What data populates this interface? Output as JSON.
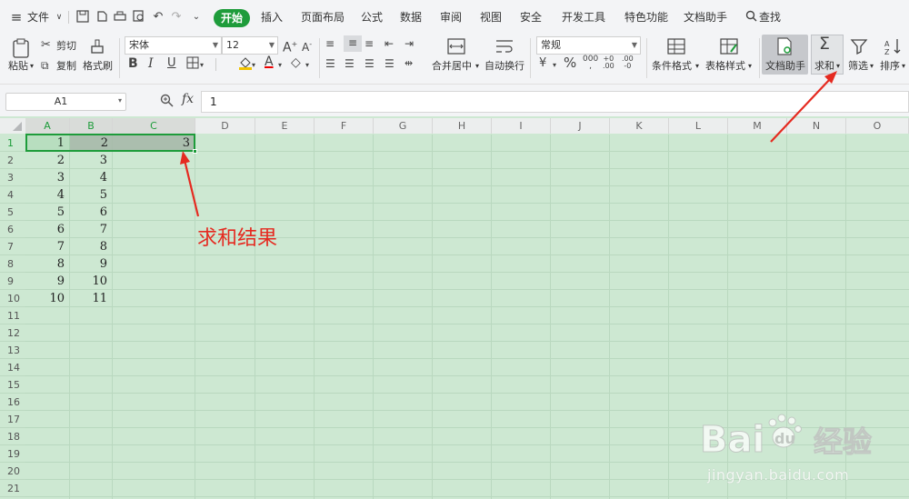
{
  "menu": {
    "file_label": "文件",
    "tabs": [
      "开始",
      "插入",
      "页面布局",
      "公式",
      "数据",
      "审阅",
      "视图",
      "安全",
      "开发工具",
      "特色功能",
      "文档助手"
    ],
    "search_label": "查找"
  },
  "ribbon": {
    "paste_label": "粘贴",
    "cut_label": "剪切",
    "copy_label": "复制",
    "format_painter_label": "格式刷",
    "font_name": "宋体",
    "font_size": "12",
    "merge_center_label": "合并居中",
    "wrap_text_label": "自动换行",
    "number_format": "常规",
    "conditional_format_label": "条件格式",
    "table_style_label": "表格样式",
    "doc_assistant_label": "文档助手",
    "sum_label": "求和",
    "filter_label": "筛选",
    "sort_label": "排序",
    "bold_label": "B",
    "italic_label": "I",
    "underline_label": "U",
    "font_color_label": "A"
  },
  "formula_bar": {
    "name_box": "A1",
    "fx_label": "fx",
    "formula_value": "1"
  },
  "sheet": {
    "columns": [
      "A",
      "B",
      "C",
      "D",
      "E",
      "F",
      "G",
      "H",
      "I",
      "J",
      "K",
      "L",
      "M",
      "N",
      "O"
    ],
    "row_numbers": [
      "1",
      "2",
      "3",
      "4",
      "5",
      "6",
      "7",
      "8",
      "9",
      "10",
      "11",
      "12",
      "13",
      "14",
      "15",
      "16",
      "17",
      "18",
      "19",
      "20",
      "21"
    ],
    "rows": [
      [
        "1",
        "2",
        "3"
      ],
      [
        "2",
        "3",
        ""
      ],
      [
        "3",
        "4",
        ""
      ],
      [
        "4",
        "5",
        ""
      ],
      [
        "5",
        "6",
        ""
      ],
      [
        "6",
        "7",
        ""
      ],
      [
        "7",
        "8",
        ""
      ],
      [
        "8",
        "9",
        ""
      ],
      [
        "9",
        "10",
        ""
      ],
      [
        "10",
        "11",
        ""
      ]
    ]
  },
  "annotation": {
    "text": "求和结果",
    "color": "#e52a20"
  },
  "watermark": {
    "brand": "Bai du 经验",
    "url": "jingyan.baidu.com"
  },
  "colors": {
    "accent": "#1e9c3b",
    "grid_bg": "#cde8d2",
    "selection_border": "#1e9c3b",
    "annotation": "#e52a20"
  }
}
